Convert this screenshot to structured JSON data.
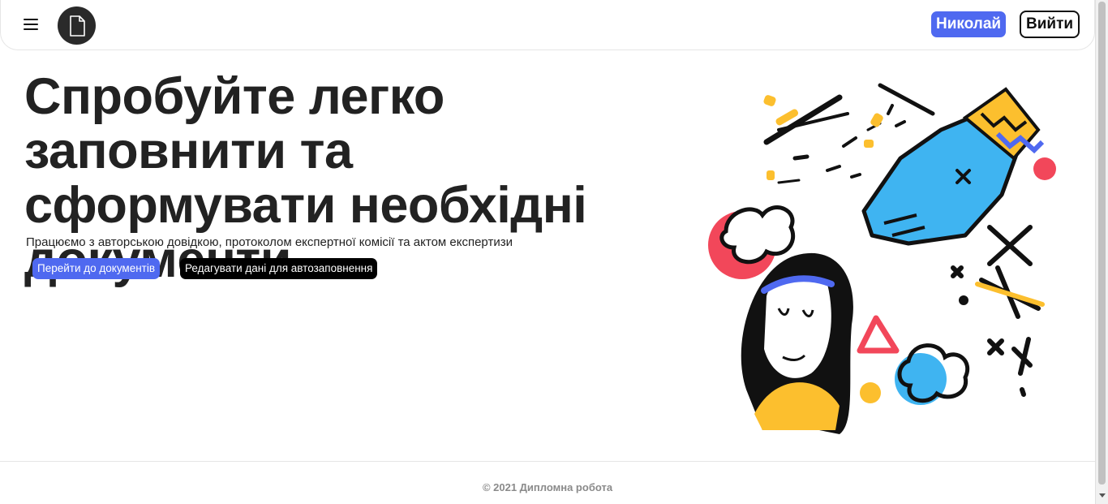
{
  "header": {
    "menu_icon": "hamburger-menu-icon",
    "logo_icon": "document-icon",
    "user_button_label": "Николай",
    "logout_button_label": "Вийти"
  },
  "hero": {
    "title": "Спробуйте легко заповнити та сформувати необхідні документи",
    "subtitle": "Працюємо з авторською довідкою, протоколом експертної комісії та актом експертизи",
    "docs_button_label": "Перейти до документів",
    "edit_button_label": "Редагувати дані для автозаповнення",
    "illustration_icon": "hero-illustration"
  },
  "footer": {
    "copyright": "© 2021 Дипломна робота"
  },
  "colors": {
    "accent": "#4f69f0",
    "dark": "#000000",
    "yellow": "#fcbf2e",
    "red": "#f2475a",
    "blue": "#3fb4f1"
  }
}
